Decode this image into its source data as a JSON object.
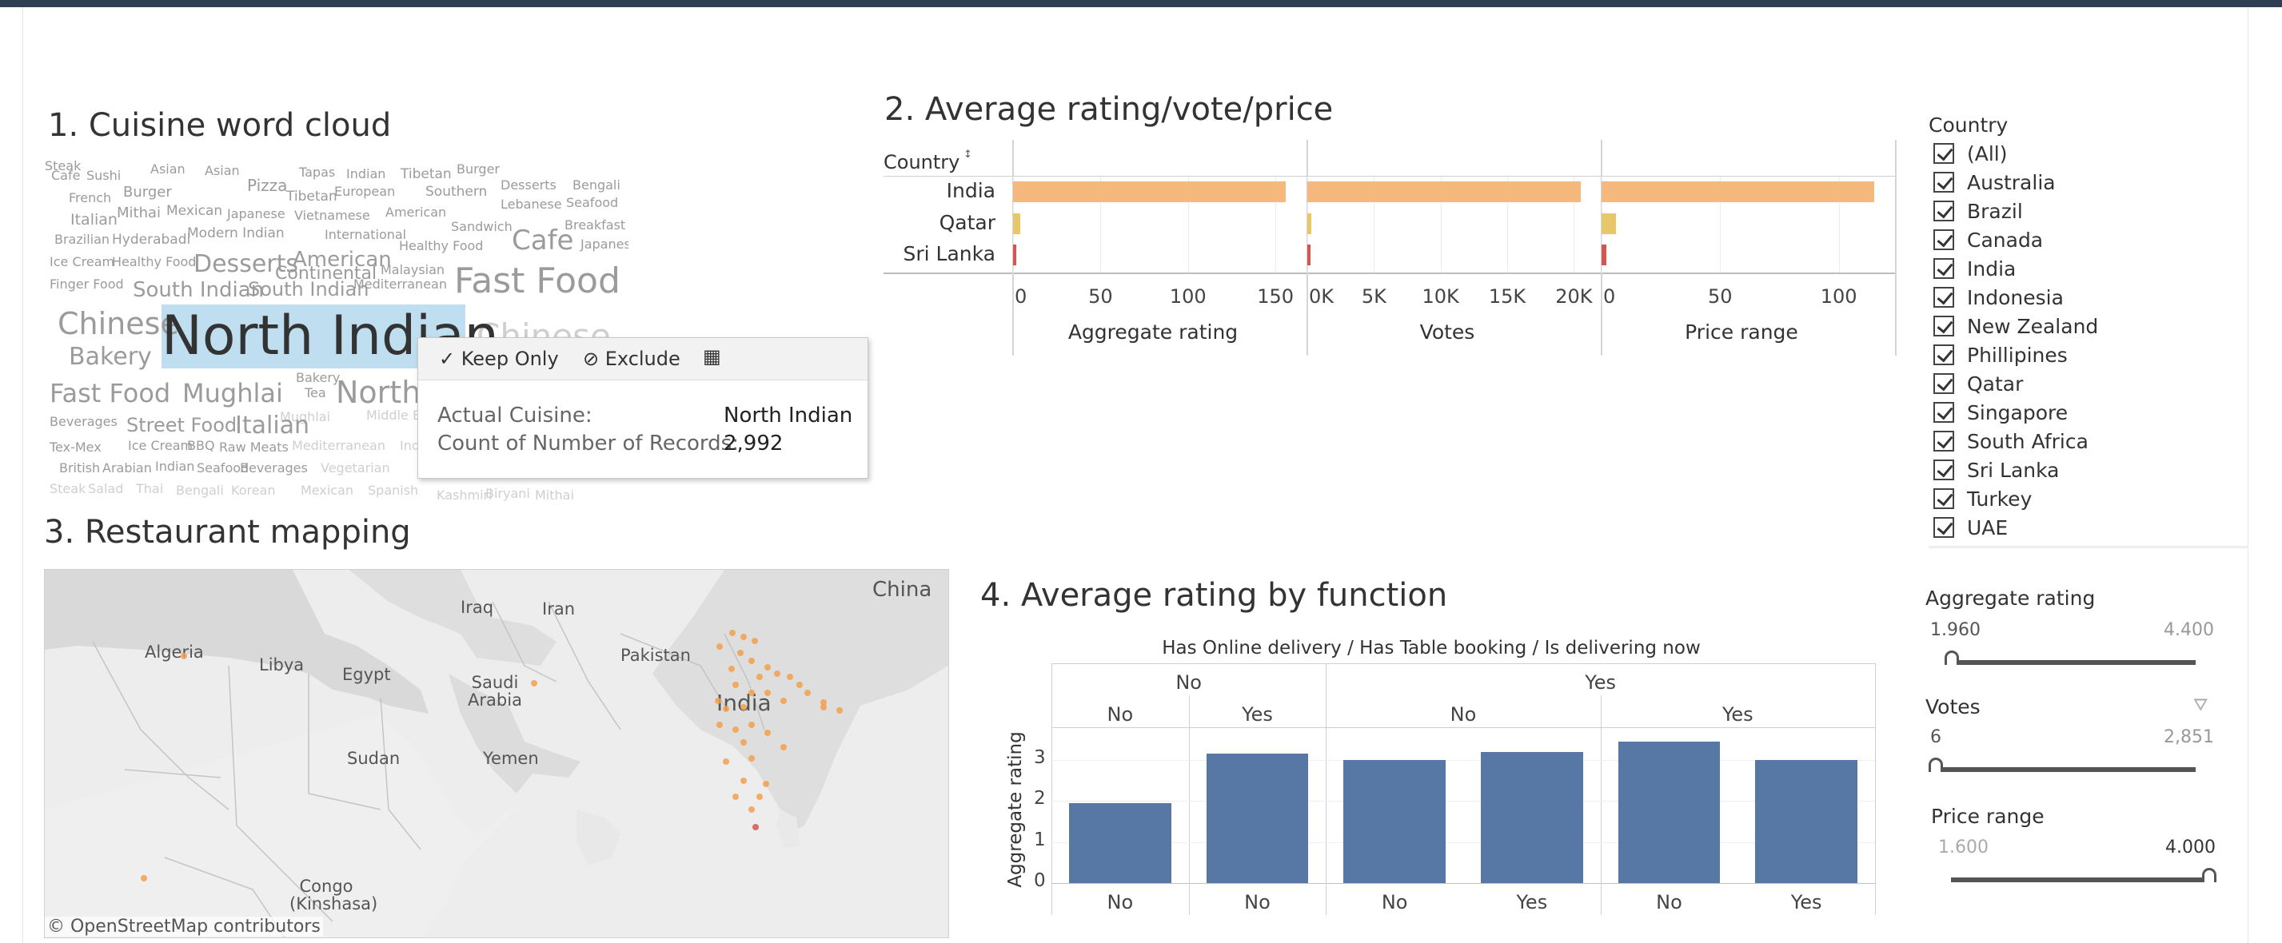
{
  "titles": {
    "cloud": "1. Cuisine word cloud",
    "avg": "2. Average rating/vote/price",
    "mapping": "3. Restaurant mapping",
    "function": "4. Average rating by function"
  },
  "word_cloud": {
    "selected": "North Indian",
    "words_tiny": [
      "Cafe",
      "Sushi",
      "Asian",
      "Asian",
      "Pizza",
      "Tapas",
      "Indian",
      "Tibetan",
      "Burger",
      "French",
      "Burger",
      "Tibetan",
      "European",
      "Southern",
      "Desserts",
      "Bengali",
      "Italian",
      "Mithai",
      "Mexican",
      "Japanese",
      "Vietnamese",
      "American",
      "Lebanese",
      "Seafood",
      "Brazilian",
      "Hyderabadi",
      "Modern Indian",
      "International",
      "Sandwich",
      "Breakfast",
      "Ice Cream",
      "Healthy Food",
      "Healthy Food",
      "Japanese",
      "Malaysian",
      "Finger Food",
      "Mediterranean",
      "Bakery",
      "Tea",
      "Beverages",
      "Mughlai",
      "Middle Ea...",
      "Tex-Mex",
      "Ice Cream",
      "BBQ",
      "Raw Meats",
      "Mediterranean",
      "Ind...",
      "British",
      "Arabian",
      "Indian",
      "Seafood",
      "Beverages",
      "Vegetarian",
      "Steak",
      "Salad",
      "Thai",
      "Bengali",
      "Korean",
      "Mexican",
      "Spanish",
      "Kashmiri",
      "Biryani",
      "Mithai",
      "Steak"
    ],
    "words_medium": [
      "Continental",
      "Desserts",
      "American",
      "South Indian",
      "South Indian",
      "Chinese",
      "Bakery",
      "Fast Food",
      "Mughlai",
      "Street Food",
      "Italian"
    ],
    "words_large": [
      "Cafe",
      "Fast Food",
      "North",
      "Chinese"
    ]
  },
  "tooltip": {
    "keep_only": "Keep Only",
    "exclude": "Exclude",
    "actual_cuisine_label": "Actual Cuisine:",
    "actual_cuisine_value": "North Indian",
    "count_label": "Count of Number of Records:",
    "count_value": "2,992"
  },
  "chart_avg": {
    "row_header": "Country",
    "chart_data": {
      "type": "bar",
      "orientation": "horizontal",
      "categories": [
        "India",
        "Qatar",
        "Sri Lanka"
      ],
      "panels": [
        {
          "name": "Aggregate rating",
          "values": [
            156,
            4,
            2
          ],
          "ticks": [
            "0",
            "50",
            "100",
            "150"
          ],
          "xlim": [
            0,
            160
          ]
        },
        {
          "name": "Votes",
          "values": [
            20500,
            300,
            150
          ],
          "ticks": [
            "0K",
            "5K",
            "10K",
            "15K",
            "20K"
          ],
          "xlim": [
            0,
            21000
          ]
        },
        {
          "name": "Price range",
          "values": [
            115,
            6,
            2
          ],
          "ticks": [
            "0",
            "50",
            "100"
          ],
          "xlim": [
            0,
            118
          ]
        }
      ],
      "colors": [
        "#f6b97d",
        "#e8c76a",
        "#d9534f"
      ]
    }
  },
  "filters": {
    "country_title": "Country",
    "countries": [
      "(All)",
      "Australia",
      "Brazil",
      "Canada",
      "India",
      "Indonesia",
      "New Zealand",
      "Phillipines",
      "Qatar",
      "Singapore",
      "South Africa",
      "Sri Lanka",
      "Turkey",
      "UAE"
    ],
    "agg_title": "Aggregate rating",
    "agg_min": "1.960",
    "agg_max": "4.400",
    "votes_title": "Votes",
    "votes_min": "6",
    "votes_max": "2,851",
    "price_title": "Price range",
    "price_min": "1.600",
    "price_max": "4.000"
  },
  "map": {
    "labels": [
      "China",
      "Iraq",
      "Iran",
      "Algeria",
      "Libya",
      "Egypt",
      "Saudi Arabia",
      "Pakistan",
      "India",
      "Sudan",
      "Yemen",
      "Congo (Kinshasa)"
    ],
    "attribution": "© OpenStreetMap contributors"
  },
  "chart_fn": {
    "header": "Has Online delivery  /  Has Table booking  /  Is delivering now",
    "ylabel": "Aggregate rating",
    "chart_data": {
      "type": "bar",
      "groups": [
        {
          "online": "No",
          "table": "No",
          "now": "No",
          "value": 1.95
        },
        {
          "online": "No",
          "table": "Yes",
          "now": "No",
          "value": 3.15
        },
        {
          "online": "Yes",
          "table": "No",
          "now": "No",
          "value": 3.0
        },
        {
          "online": "Yes",
          "table": "No",
          "now": "Yes",
          "value": 3.2
        },
        {
          "online": "Yes",
          "table": "Yes",
          "now": "No",
          "value": 3.45
        },
        {
          "online": "Yes",
          "table": "Yes",
          "now": "Yes",
          "value": 3.0
        }
      ],
      "yticks": [
        "0",
        "1",
        "2",
        "3"
      ],
      "ylim": [
        0,
        3.6
      ],
      "color": "#5778a4"
    }
  }
}
